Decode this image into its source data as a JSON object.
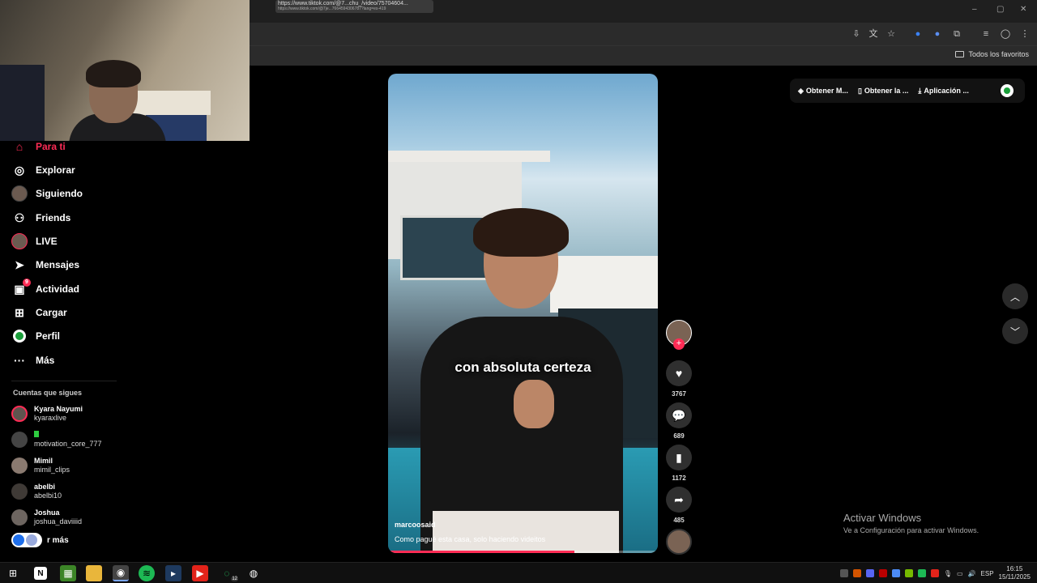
{
  "browser": {
    "url_tooltip_line1": "https://www.tiktok.com/@7...chu_/video/75704604...",
    "url_tooltip_line2": "https://www.tiktok.com/@7je...7664594306787?lang=es-419",
    "bookmarks_folder": "Todos los favoritos"
  },
  "sidebar": {
    "items": [
      {
        "label": "Para ti",
        "icon": "home-icon"
      },
      {
        "label": "Explorar",
        "icon": "compass-icon"
      },
      {
        "label": "Siguiendo",
        "icon": "following-avatar-icon"
      },
      {
        "label": "Friends",
        "icon": "friends-icon"
      },
      {
        "label": "LIVE",
        "icon": "live-icon"
      },
      {
        "label": "Mensajes",
        "icon": "messages-icon"
      },
      {
        "label": "Actividad",
        "icon": "activity-icon",
        "badge": "9"
      },
      {
        "label": "Cargar",
        "icon": "upload-icon"
      },
      {
        "label": "Perfil",
        "icon": "profile-icon"
      },
      {
        "label": "Más",
        "icon": "more-icon"
      }
    ],
    "following_title": "Cuentas que sigues",
    "accounts": [
      {
        "name": "Kyara Nayumi",
        "handle": "kyaraxlive"
      },
      {
        "name": "",
        "handle": "motivation_core_777"
      },
      {
        "name": "Mimil",
        "handle": "mimil_clips"
      },
      {
        "name": "abelbi",
        "handle": "abelbi10"
      },
      {
        "name": "Joshua",
        "handle": "joshua_daviiiid"
      }
    ],
    "see_more": "r más"
  },
  "video": {
    "overlay_text": "con absoluta certeza",
    "username": "marcoosaid",
    "description": "Como pagué esta casa, solo haciendo videitos",
    "progress": 0.69
  },
  "actions": {
    "likes": "3767",
    "comments": "689",
    "saves": "1172",
    "shares": "485"
  },
  "topbar": {
    "item1": "Obtener M...",
    "item2": "Obtener la ...",
    "item3": "Aplicación ..."
  },
  "windows": {
    "activate_title": "Activar Windows",
    "activate_sub": "Ve a Configuración para activar Windows.",
    "lang": "ESP",
    "time": "16:15",
    "date": "15/11/2025",
    "whatsapp_badge": "12"
  },
  "colors": {
    "accent": "#fe2c55",
    "background": "#000000"
  }
}
